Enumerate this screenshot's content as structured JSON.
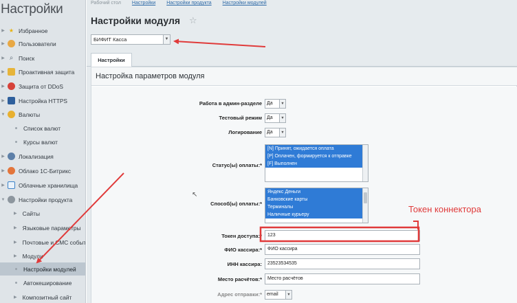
{
  "sidebar": {
    "title": "Настройки",
    "items": [
      {
        "label": "Избранное",
        "icon": "star-icon",
        "level": 0
      },
      {
        "label": "Пользователи",
        "icon": "user-icon",
        "level": 0
      },
      {
        "label": "Поиск",
        "icon": "search-icon",
        "level": 0
      },
      {
        "label": "Проактивная защита",
        "icon": "lock-icon",
        "level": 0
      },
      {
        "label": "Защита от DDoS",
        "icon": "shield-icon",
        "level": 0
      },
      {
        "label": "Настройка HTTPS",
        "icon": "https-icon",
        "level": 0
      },
      {
        "label": "Валюты",
        "icon": "currency-icon",
        "level": 0
      },
      {
        "label": "Список валют",
        "level": 1
      },
      {
        "label": "Курсы валют",
        "level": 1
      },
      {
        "label": "Локализация",
        "icon": "globe-icon",
        "level": 0
      },
      {
        "label": "Облако 1С-Битрикс",
        "icon": "cloud-icon",
        "level": 0
      },
      {
        "label": "Облачные хранилища",
        "icon": "storage-icon",
        "level": 0
      },
      {
        "label": "Настройки продукта",
        "icon": "settings-icon",
        "level": 0
      },
      {
        "label": "Сайты",
        "level": 1
      },
      {
        "label": "Языковые параметры",
        "level": 1
      },
      {
        "label": "Почтовые и СМС события",
        "level": 1
      },
      {
        "label": "Модули",
        "level": 1
      },
      {
        "label": "Настройки модулей",
        "level": 1,
        "active": true
      },
      {
        "label": "Автокеширование",
        "level": 1
      },
      {
        "label": "Композитный сайт",
        "level": 1
      }
    ]
  },
  "main": {
    "breadcrumb": {
      "lead": "Рабочий стол",
      "links": [
        "Настройки",
        "Настройки продукта",
        "Настройки модулей"
      ]
    },
    "page_title": "Настройки модуля",
    "module_select": "БИФИТ Касса",
    "tab_label": "Настройки",
    "panel_title": "Настройка параметров модуля",
    "fields": {
      "admin_work": {
        "label": "Работа в админ-разделе",
        "value": "Да"
      },
      "test_mode": {
        "label": "Тестовый режим",
        "value": "Да"
      },
      "logging": {
        "label": "Логирование",
        "value": "Да"
      },
      "pay_status": {
        "label": "Статус(ы) оплаты:*",
        "options": [
          "[N] Принят, ожидается оплата",
          "[P] Оплачен, формируется к отправке",
          "[F] Выполнен"
        ]
      },
      "pay_methods": {
        "label": "Способ(ы) оплаты:*",
        "options": [
          "Яндекс Деньги",
          "Банковские карты",
          "Терминалы",
          "Наличные курьеру"
        ]
      },
      "access_token": {
        "label": "Токен доступа:*",
        "value": "123"
      },
      "cashier_name": {
        "label": "ФИО кассира:*",
        "value": "ФИО кассира"
      },
      "cashier_inn": {
        "label": "ИНН кассира:",
        "value": "23523534535"
      },
      "payment_place": {
        "label": "Место расчётов:*",
        "value": "Место расчётов"
      },
      "partial_row": {
        "label": "Адрес отправки:*",
        "value": "email"
      }
    }
  },
  "annotation": {
    "text": "Токен коннектора",
    "color": "#e03a3a"
  }
}
